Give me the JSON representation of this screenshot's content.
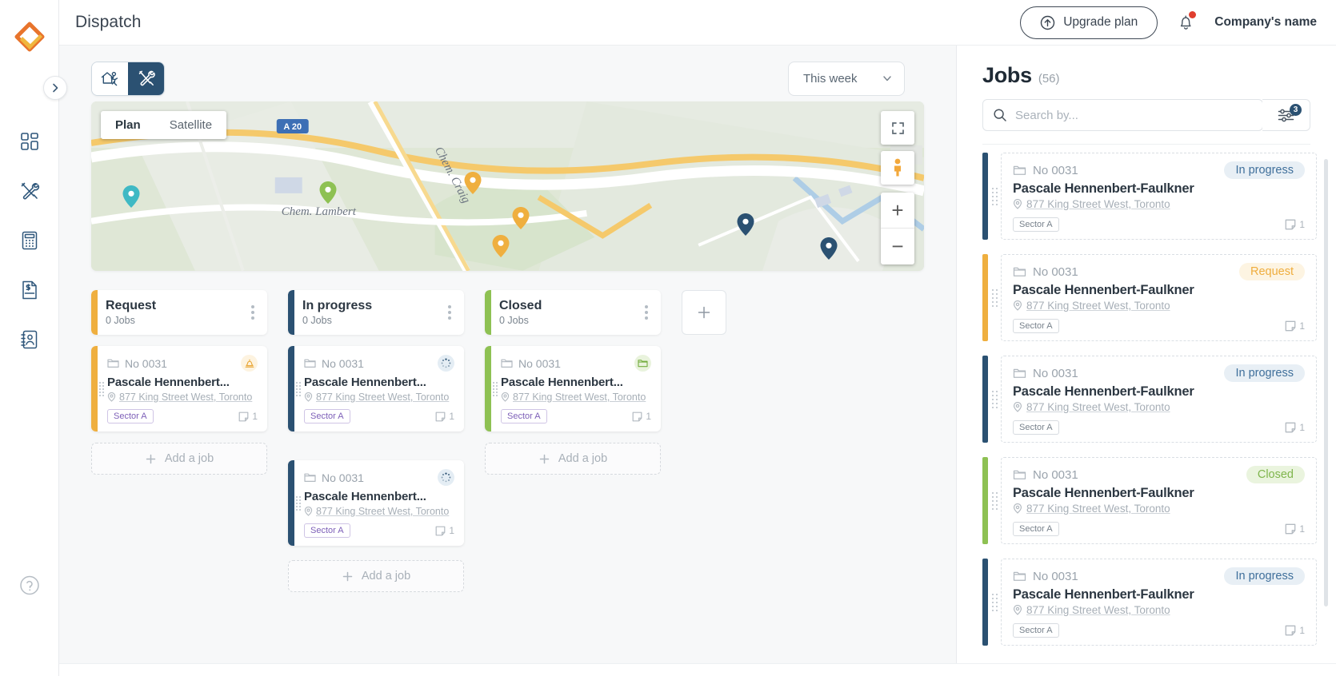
{
  "header": {
    "page_title": "Dispatch",
    "upgrade_label": "Upgrade plan",
    "company_name": "Company's name",
    "upgrade_icon": "arrow-up-circle-icon",
    "bell_icon": "notification-bell-icon"
  },
  "rail": {
    "logo_icon": "brand-diamond-logo",
    "expand_icon": "chevron-right-icon",
    "help_icon": "help-circle-icon",
    "items": [
      {
        "icon": "dashboard-grid-icon",
        "name": "dashboard"
      },
      {
        "icon": "tools-icon",
        "name": "jobs"
      },
      {
        "icon": "calculator-icon",
        "name": "estimates"
      },
      {
        "icon": "invoice-dollar-icon",
        "name": "invoices"
      },
      {
        "icon": "contacts-book-icon",
        "name": "contacts"
      }
    ]
  },
  "toolbar": {
    "view_map_icon": "house-worker-icon",
    "view_jobs_icon": "tools-icon",
    "active_view": "jobs",
    "period_label": "This week",
    "period_icon": "chevron-down-icon"
  },
  "map": {
    "type_plan": "Plan",
    "type_satellite": "Satellite",
    "selected_type": "Plan",
    "fullscreen_icon": "fullscreen-icon",
    "pegman_icon": "street-view-pegman-icon",
    "zoom_in": "+",
    "zoom_out": "−",
    "labels": [
      {
        "text": "A 20",
        "type": "highway-shield"
      },
      {
        "text": "Chem. Craig",
        "type": "street"
      },
      {
        "text": "Chem. Lambert",
        "type": "street"
      }
    ]
  },
  "board": {
    "add_job_label": "Add a job",
    "add_column_icon": "plus-icon",
    "columns": [
      {
        "title": "Request",
        "subtitle": "0 Jobs",
        "color": "#efaf3f",
        "show_add": true,
        "cards": [
          {
            "no": "No 0031",
            "name": "Pascale Hennenbert...",
            "address": "877 King Street West, Toronto",
            "tag": "Sector A",
            "notes": "1",
            "status_icon": "bell-alert-icon",
            "status_icon_color": "#e9a93c",
            "status_icon_bg": "#fdf3e0"
          }
        ]
      },
      {
        "title": "In progress",
        "subtitle": "0 Jobs",
        "color": "#2b5172",
        "show_add": false,
        "cards": [
          {
            "no": "No 0031",
            "name": "Pascale Hennenbert...",
            "address": "877 King Street West, Toronto",
            "tag": "Sector A",
            "notes": "1",
            "status_icon": "spinner-icon",
            "status_icon_color": "#2b5172",
            "status_icon_bg": "#e4edf4"
          },
          {
            "no": "No 0031",
            "name": "Pascale Hennenbert...",
            "address": "877 King Street West, Toronto",
            "tag": "Sector A",
            "notes": "1",
            "status_icon": "spinner-icon",
            "status_icon_color": "#2b5172",
            "status_icon_bg": "#e4edf4"
          }
        ]
      },
      {
        "title": "Closed",
        "subtitle": "0 Jobs",
        "color": "#8ec153",
        "show_add": true,
        "cards": [
          {
            "no": "No 0031",
            "name": "Pascale Hennenbert...",
            "address": "877 King Street West, Toronto",
            "tag": "Sector A",
            "notes": "1",
            "status_icon": "folder-icon",
            "status_icon_color": "#74ad3e",
            "status_icon_bg": "#e9f3dd"
          }
        ]
      }
    ]
  },
  "jobs": {
    "title": "Jobs",
    "count": "(56)",
    "search_placeholder": "Search by...",
    "search_value": "",
    "search_icon": "search-icon",
    "filter_icon": "filter-sliders-icon",
    "filter_count": "3",
    "items": [
      {
        "no": "No 0031",
        "status": "In progress",
        "status_bg": "#e8eff5",
        "status_fg": "#3f6f9b",
        "bar": "#2b5172",
        "name": "Pascale Hennenbert-Faulkner",
        "address": "877 King Street West, Toronto",
        "tag": "Sector A",
        "notes": "1"
      },
      {
        "no": "No 0031",
        "status": "Request",
        "status_bg": "#fdf4e2",
        "status_fg": "#efad3d",
        "bar": "#efaf3f",
        "name": "Pascale Hennenbert-Faulkner",
        "address": "877 King Street West, Toronto",
        "tag": "Sector A",
        "notes": "1"
      },
      {
        "no": "No 0031",
        "status": "In progress",
        "status_bg": "#e8eff5",
        "status_fg": "#3f6f9b",
        "bar": "#2b5172",
        "name": "Pascale Hennenbert-Faulkner",
        "address": "877 King Street West, Toronto",
        "tag": "Sector A",
        "notes": "1"
      },
      {
        "no": "No 0031",
        "status": "Closed",
        "status_bg": "#eaf4de",
        "status_fg": "#7fb54c",
        "bar": "#8ec153",
        "name": "Pascale Hennenbert-Faulkner",
        "address": "877 King Street West, Toronto",
        "tag": "Sector A",
        "notes": "1"
      },
      {
        "no": "No 0031",
        "status": "In progress",
        "status_bg": "#e8eff5",
        "status_fg": "#3f6f9b",
        "bar": "#2b5172",
        "name": "Pascale Hennenbert-Faulkner",
        "address": "877 King Street West, Toronto",
        "tag": "Sector A",
        "notes": "1"
      }
    ]
  },
  "colors": {
    "brand_navy": "#2b5172",
    "request_amber": "#efaf3f",
    "closed_green": "#8ec153",
    "sector_purple": "#7d5fb8"
  }
}
